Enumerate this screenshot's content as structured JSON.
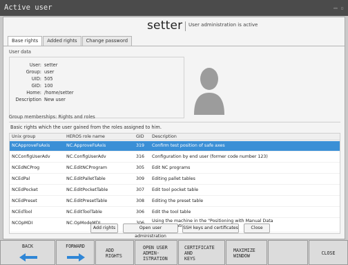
{
  "window": {
    "title": "Active user"
  },
  "header": {
    "brand": "setter",
    "status": "User administration is active"
  },
  "tabs": [
    {
      "label": "Base rights",
      "active": true
    },
    {
      "label": "Added rights",
      "active": false
    },
    {
      "label": "Change password",
      "active": false
    }
  ],
  "user_data": {
    "section_label": "User data",
    "rows": [
      {
        "key": "User:",
        "value": "setter"
      },
      {
        "key": "Group:",
        "value": "user"
      },
      {
        "key": "UID:",
        "value": "505"
      },
      {
        "key": "GID:",
        "value": "100"
      },
      {
        "key": "Home:",
        "value": "/home/setter"
      },
      {
        "key": "Description",
        "value": "New user"
      }
    ]
  },
  "group_memberships": {
    "label": "Group memberships: Rights and roles",
    "basic_note": "Basic rights which the user gained from the roles assigned to him.",
    "columns": [
      "Unix group",
      "HEROS role name",
      "GID",
      "Description"
    ],
    "rows": [
      {
        "unix": "NCApproveFsAxis",
        "role": "NC.ApproveFsAxis",
        "gid": "319",
        "desc": "Confirm test position of safe axes",
        "selected": true
      },
      {
        "unix": "NCConfigUserAdv",
        "role": "NC.ConfigUserAdv",
        "gid": "316",
        "desc": "Configuration by end user (former code number 123)",
        "selected": false
      },
      {
        "unix": "NCEdNCProg",
        "role": "NC.EditNCProgram",
        "gid": "305",
        "desc": "Edit NC programs",
        "selected": false
      },
      {
        "unix": "NCEdPal",
        "role": "NC.EditPalletTable",
        "gid": "309",
        "desc": "Editing pallet tables",
        "selected": false
      },
      {
        "unix": "NCEdPocket",
        "role": "NC.EditPocketTable",
        "gid": "307",
        "desc": "Edit tool pocket table",
        "selected": false
      },
      {
        "unix": "NCEdPreset",
        "role": "NC.EditPresetTable",
        "gid": "308",
        "desc": "Editing the preset table",
        "selected": false
      },
      {
        "unix": "NCEdTool",
        "role": "NC.EditToolTable",
        "gid": "306",
        "desc": "Edit the tool table",
        "selected": false
      },
      {
        "unix": "NCOpMDI",
        "role": "NC.OpModeMDI",
        "gid": "306",
        "desc": "Using the machine in the \"Positioning with Manual Data Input\" operating mode",
        "selected": false
      }
    ]
  },
  "dialog_buttons": {
    "add_rights": "Add rights",
    "open_admin": "Open user administration",
    "ssh": "SSH keys and certificates",
    "close": "Close"
  },
  "softkeys": {
    "back": "BACK",
    "forward": "FORWARD",
    "add_rights": "ADD\nRIGHTS",
    "open_admin": "OPEN USER\nADMIN-\nISTRATION",
    "certificate": "CERTIFICATE\nAND\nKEYS",
    "maximize": "MAXIMIZE\nWINDOW",
    "close": "CLOSE"
  },
  "colors": {
    "selection": "#3a8fd6",
    "arrow": "#2f86d6",
    "titlebar": "#4b4b4b"
  }
}
